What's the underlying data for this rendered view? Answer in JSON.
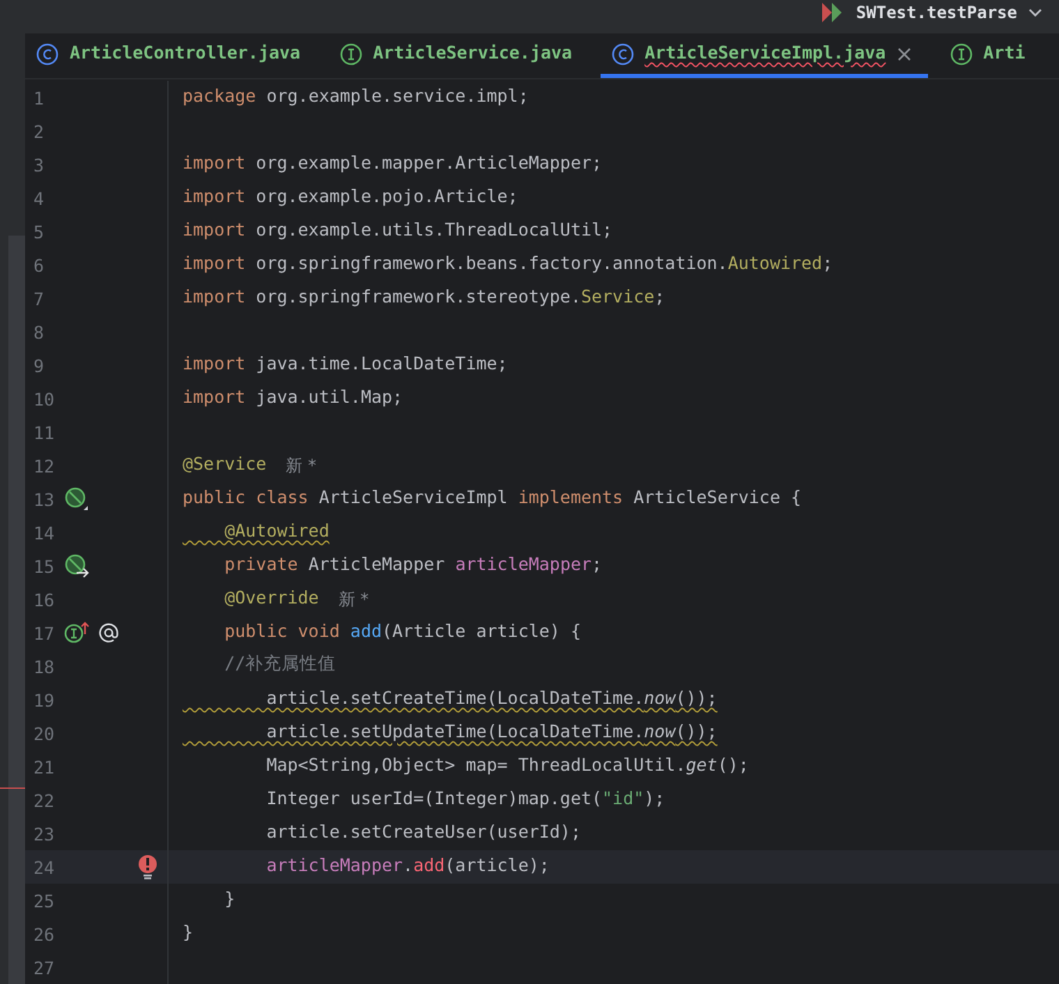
{
  "run_config": {
    "label": "SWTest.testParse"
  },
  "tabs": [
    {
      "label": "ArticleController.java",
      "kind": "class",
      "selected": false,
      "error": false
    },
    {
      "label": "ArticleService.java",
      "kind": "interface",
      "selected": false,
      "error": false
    },
    {
      "label": "ArticleServiceImpl.java",
      "kind": "class",
      "selected": true,
      "error": true
    },
    {
      "label": "Arti",
      "kind": "interface",
      "selected": false,
      "error": false
    }
  ],
  "editor": {
    "lines": [
      {
        "number": "1",
        "current": false,
        "warning": false,
        "tokens": [
          {
            "t": "package",
            "kind": "kw"
          },
          {
            "t": " org.example.service.impl;",
            "kind": "plain"
          }
        ]
      },
      {
        "number": "2",
        "current": false
      },
      {
        "number": "3",
        "current": false,
        "warning": false,
        "tokens": [
          {
            "t": "import",
            "kind": "kw"
          },
          {
            "t": " org.example.mapper.ArticleMapper;",
            "kind": "plain"
          }
        ]
      },
      {
        "number": "4",
        "current": false,
        "warning": false,
        "tokens": [
          {
            "t": "import",
            "kind": "kw"
          },
          {
            "t": " org.example.pojo.Article;",
            "kind": "plain"
          }
        ]
      },
      {
        "number": "5",
        "current": false,
        "warning": false,
        "tokens": [
          {
            "t": "import",
            "kind": "kw"
          },
          {
            "t": " org.example.utils.ThreadLocalUtil;",
            "kind": "plain"
          }
        ]
      },
      {
        "number": "6",
        "current": false,
        "warning": false,
        "tokens": [
          {
            "t": "import",
            "kind": "kw"
          },
          {
            "t": " org.springframework.beans.factory.annotation.",
            "kind": "plain"
          },
          {
            "t": "Autowired",
            "kind": "ann"
          },
          {
            "t": ";",
            "kind": "plain"
          }
        ]
      },
      {
        "number": "7",
        "current": false,
        "warning": false,
        "tokens": [
          {
            "t": "import",
            "kind": "kw"
          },
          {
            "t": " org.springframework.stereotype.",
            "kind": "plain"
          },
          {
            "t": "Service",
            "kind": "ann"
          },
          {
            "t": ";",
            "kind": "plain"
          }
        ]
      },
      {
        "number": "8",
        "current": false
      },
      {
        "number": "9",
        "current": false,
        "warning": false,
        "tokens": [
          {
            "t": "import",
            "kind": "kw"
          },
          {
            "t": " java.time.LocalDateTime;",
            "kind": "plain"
          }
        ]
      },
      {
        "number": "10",
        "current": false,
        "warning": false,
        "tokens": [
          {
            "t": "import",
            "kind": "kw"
          },
          {
            "t": " java.util.Map;",
            "kind": "plain"
          }
        ]
      },
      {
        "number": "11",
        "current": false
      },
      {
        "number": "12",
        "current": false,
        "warning": false,
        "tokens": [
          {
            "t": "@Service",
            "kind": "ann"
          }
        ],
        "hint": "新 *"
      },
      {
        "number": "13",
        "current": false,
        "warning": false,
        "gutter": [
          {
            "kind": "bean"
          }
        ],
        "tokens": [
          {
            "t": "public class",
            "kind": "kw"
          },
          {
            "t": " ArticleServiceImpl ",
            "kind": "plain"
          },
          {
            "t": "implements",
            "kind": "kw"
          },
          {
            "t": " ArticleService {",
            "kind": "plain"
          }
        ]
      },
      {
        "number": "14",
        "current": false,
        "warning": true,
        "tokens": [
          {
            "t": "    @Autowired",
            "kind": "ann"
          }
        ]
      },
      {
        "number": "15",
        "current": false,
        "warning": false,
        "gutter": [
          {
            "kind": "bean-arrow"
          }
        ],
        "tokens": [
          {
            "t": "    private",
            "kind": "kw"
          },
          {
            "t": " ArticleMapper ",
            "kind": "plain"
          },
          {
            "t": "articleMapper",
            "kind": "field"
          },
          {
            "t": ";",
            "kind": "plain"
          }
        ]
      },
      {
        "number": "16",
        "current": false,
        "warning": false,
        "tokens": [
          {
            "t": "    @Override",
            "kind": "ann"
          }
        ],
        "hint": "新 *"
      },
      {
        "number": "17",
        "current": false,
        "warning": false,
        "gutter": [
          {
            "kind": "implements"
          },
          {
            "kind": "at"
          }
        ],
        "tokens": [
          {
            "t": "    public void",
            "kind": "kw"
          },
          {
            "t": " add",
            "kind": "decl"
          },
          {
            "t": "(Article article) {",
            "kind": "plain"
          }
        ]
      },
      {
        "number": "18",
        "current": false,
        "warning": false,
        "tokens": [
          {
            "t": "    //补充属性值",
            "kind": "comment"
          }
        ]
      },
      {
        "number": "19",
        "current": false,
        "warning": true,
        "tokens": [
          {
            "t": "        article.setCreateTime(LocalDateTime.",
            "kind": "plain"
          },
          {
            "t": "now",
            "kind": "static"
          },
          {
            "t": "());",
            "kind": "plain"
          }
        ]
      },
      {
        "number": "20",
        "current": false,
        "warning": true,
        "tokens": [
          {
            "t": "        article.setUpdateTime(LocalDateTime.",
            "kind": "plain"
          },
          {
            "t": "now",
            "kind": "static"
          },
          {
            "t": "());",
            "kind": "plain"
          }
        ]
      },
      {
        "number": "21",
        "current": false,
        "warning": false,
        "tokens": [
          {
            "t": "        Map<String,Object> map= ThreadLocalUtil.",
            "kind": "plain"
          },
          {
            "t": "get",
            "kind": "static"
          },
          {
            "t": "();",
            "kind": "plain"
          }
        ]
      },
      {
        "number": "22",
        "current": false,
        "warning": false,
        "tokens": [
          {
            "t": "        Integer userId=(Integer)map.get(",
            "kind": "plain"
          },
          {
            "t": "\"id\"",
            "kind": "str"
          },
          {
            "t": ");",
            "kind": "plain"
          }
        ]
      },
      {
        "number": "23",
        "current": false,
        "warning": false,
        "tokens": [
          {
            "t": "        article.setCreateUser(userId);",
            "kind": "plain"
          }
        ]
      },
      {
        "number": "24",
        "current": true,
        "warning": false,
        "gutter": [
          {
            "kind": "error"
          }
        ],
        "tokens": [
          {
            "t": "        articleMapper",
            "kind": "field"
          },
          {
            "t": ".",
            "kind": "plain"
          },
          {
            "t": "add",
            "kind": "err"
          },
          {
            "t": "(article);",
            "kind": "plain"
          }
        ]
      },
      {
        "number": "25",
        "current": false,
        "warning": false,
        "tokens": [
          {
            "t": "    }",
            "kind": "plain"
          }
        ]
      },
      {
        "number": "26",
        "current": false,
        "warning": false,
        "tokens": [
          {
            "t": "}",
            "kind": "plain"
          }
        ]
      },
      {
        "number": "27",
        "current": false
      }
    ]
  }
}
